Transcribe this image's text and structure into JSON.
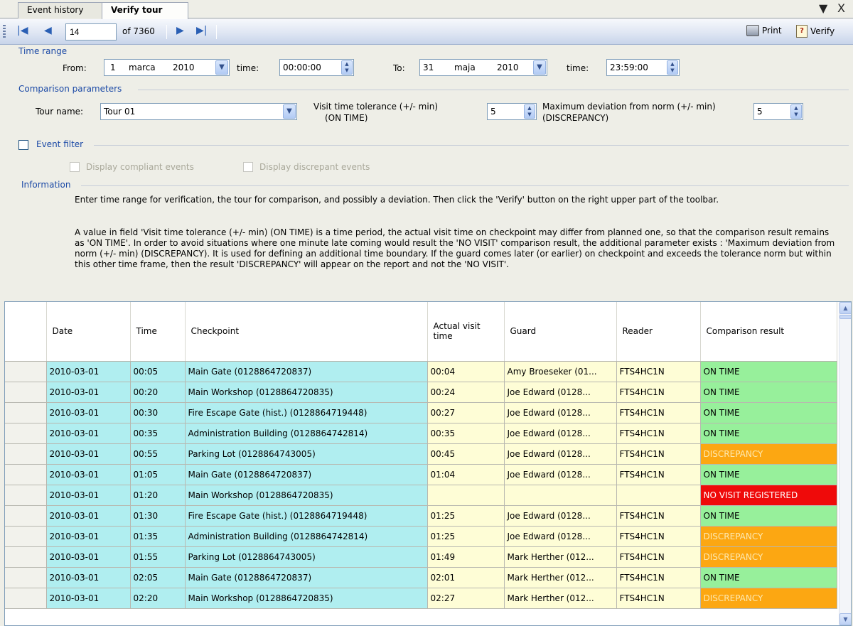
{
  "tabs": [
    {
      "label": "Event history"
    },
    {
      "label": "Verify tour"
    }
  ],
  "window_buttons": {
    "dropdown": "▼",
    "close": "X"
  },
  "toolbar": {
    "page_value": "14",
    "page_of": "of 7360",
    "print_label": "Print",
    "verify_label": "Verify"
  },
  "time_range": {
    "title": "Time range",
    "from_label": "From:",
    "from_day": "1",
    "from_month": "marca",
    "from_year": "2010",
    "time_label": "time:",
    "from_time": "00:00:00",
    "to_label": "To:",
    "to_day": "31",
    "to_month": "maja",
    "to_year": "2010",
    "to_time": "23:59:00"
  },
  "comparison": {
    "title": "Comparison parameters",
    "tour_label": "Tour name:",
    "tour_value": "Tour 01",
    "tolerance_label_1": "Visit time tolerance (+/- min)",
    "tolerance_label_2": "(ON TIME)",
    "tolerance_value": "5",
    "deviation_label_1": "Maximum deviation from norm (+/- min)",
    "deviation_label_2": "(DISCREPANCY)",
    "deviation_value": "5"
  },
  "event_filter": {
    "label": "Event filter",
    "compliant_label": "Display compliant events",
    "discrepant_label": "Display discrepant events"
  },
  "information": {
    "title": "Information",
    "para1": "Enter time range for verification, the tour for comparison, and possibly a deviation. Then click the 'Verify' button on the right upper part of the toolbar.",
    "para2": "A value in field 'Visit time tolerance (+/- min) (ON TIME) is a time period, the actual visit time on checkpoint may differ from planned one, so that the comparison result remains as 'ON TIME'. In order to avoid situations where one minute late coming would result the 'NO VISIT' comparison result, the additional parameter exists : 'Maximum deviation from norm (+/- min) (DISCREPANCY). It is used for defining an additional time boundary. If the guard comes later (or earlier) on checkpoint and exceeds the tolerance norm but within this other time frame, then the result 'DISCREPANCY' will appear on the report and not the 'NO VISIT'."
  },
  "grid": {
    "headers": [
      "Date",
      "Time",
      "Checkpoint",
      "Actual visit time",
      "Guard",
      "Reader",
      "Comparison result"
    ],
    "rows": [
      {
        "date": "2010-03-01",
        "time": "00:05",
        "checkpoint": "Main Gate (0128864720837)",
        "actual": "00:04",
        "guard": "Amy Broeseker (01...",
        "reader": "FTS4HC1N",
        "result": "ON TIME",
        "status": "ON"
      },
      {
        "date": "2010-03-01",
        "time": "00:20",
        "checkpoint": "Main Workshop (0128864720835)",
        "actual": "00:24",
        "guard": "Joe Edward (0128...",
        "reader": "FTS4HC1N",
        "result": "ON TIME",
        "status": "ON"
      },
      {
        "date": "2010-03-01",
        "time": "00:30",
        "checkpoint": "Fire Escape Gate (hist.) (0128864719448)",
        "actual": "00:27",
        "guard": "Joe Edward (0128...",
        "reader": "FTS4HC1N",
        "result": "ON TIME",
        "status": "ON"
      },
      {
        "date": "2010-03-01",
        "time": "00:35",
        "checkpoint": "Administration Building (0128864742814)",
        "actual": "00:35",
        "guard": "Joe Edward (0128...",
        "reader": "FTS4HC1N",
        "result": "ON TIME",
        "status": "ON"
      },
      {
        "date": "2010-03-01",
        "time": "00:55",
        "checkpoint": "Parking Lot (0128864743005)",
        "actual": "00:45",
        "guard": "Joe Edward (0128...",
        "reader": "FTS4HC1N",
        "result": "DISCREPANCY",
        "status": "DIS"
      },
      {
        "date": "2010-03-01",
        "time": "01:05",
        "checkpoint": "Main Gate (0128864720837)",
        "actual": "01:04",
        "guard": "Joe Edward (0128...",
        "reader": "FTS4HC1N",
        "result": "ON TIME",
        "status": "ON"
      },
      {
        "date": "2010-03-01",
        "time": "01:20",
        "checkpoint": "Main Workshop (0128864720835)",
        "actual": "",
        "guard": "",
        "reader": "",
        "result": "NO VISIT REGISTERED",
        "status": "NO"
      },
      {
        "date": "2010-03-01",
        "time": "01:30",
        "checkpoint": "Fire Escape Gate (hist.) (0128864719448)",
        "actual": "01:25",
        "guard": "Joe Edward (0128...",
        "reader": "FTS4HC1N",
        "result": "ON TIME",
        "status": "ON"
      },
      {
        "date": "2010-03-01",
        "time": "01:35",
        "checkpoint": "Administration Building (0128864742814)",
        "actual": "01:25",
        "guard": "Joe Edward (0128...",
        "reader": "FTS4HC1N",
        "result": "DISCREPANCY",
        "status": "DIS"
      },
      {
        "date": "2010-03-01",
        "time": "01:55",
        "checkpoint": "Parking Lot (0128864743005)",
        "actual": "01:49",
        "guard": "Mark Herther (012...",
        "reader": "FTS4HC1N",
        "result": "DISCREPANCY",
        "status": "DIS"
      },
      {
        "date": "2010-03-01",
        "time": "02:05",
        "checkpoint": "Main Gate (0128864720837)",
        "actual": "02:01",
        "guard": "Mark Herther (012...",
        "reader": "FTS4HC1N",
        "result": "ON TIME",
        "status": "ON"
      },
      {
        "date": "2010-03-01",
        "time": "02:20",
        "checkpoint": "Main Workshop (0128864720835)",
        "actual": "02:27",
        "guard": "Mark Herther (012...",
        "reader": "FTS4HC1N",
        "result": "DISCREPANCY",
        "status": "DIS"
      }
    ]
  },
  "colors": {
    "section_title": "#1c4aa6",
    "planned_cells": "#b0eef0",
    "actual_cells": "#fefdd6",
    "on_time": "#97f09b",
    "discrepancy": "#fca712",
    "no_visit": "#ef0a0a"
  },
  "icons": [
    "first-page-icon",
    "prev-page-icon",
    "next-page-icon",
    "last-page-icon",
    "print-icon",
    "verify-icon",
    "dropdown-arrow-icon",
    "spin-icon",
    "close-icon"
  ]
}
